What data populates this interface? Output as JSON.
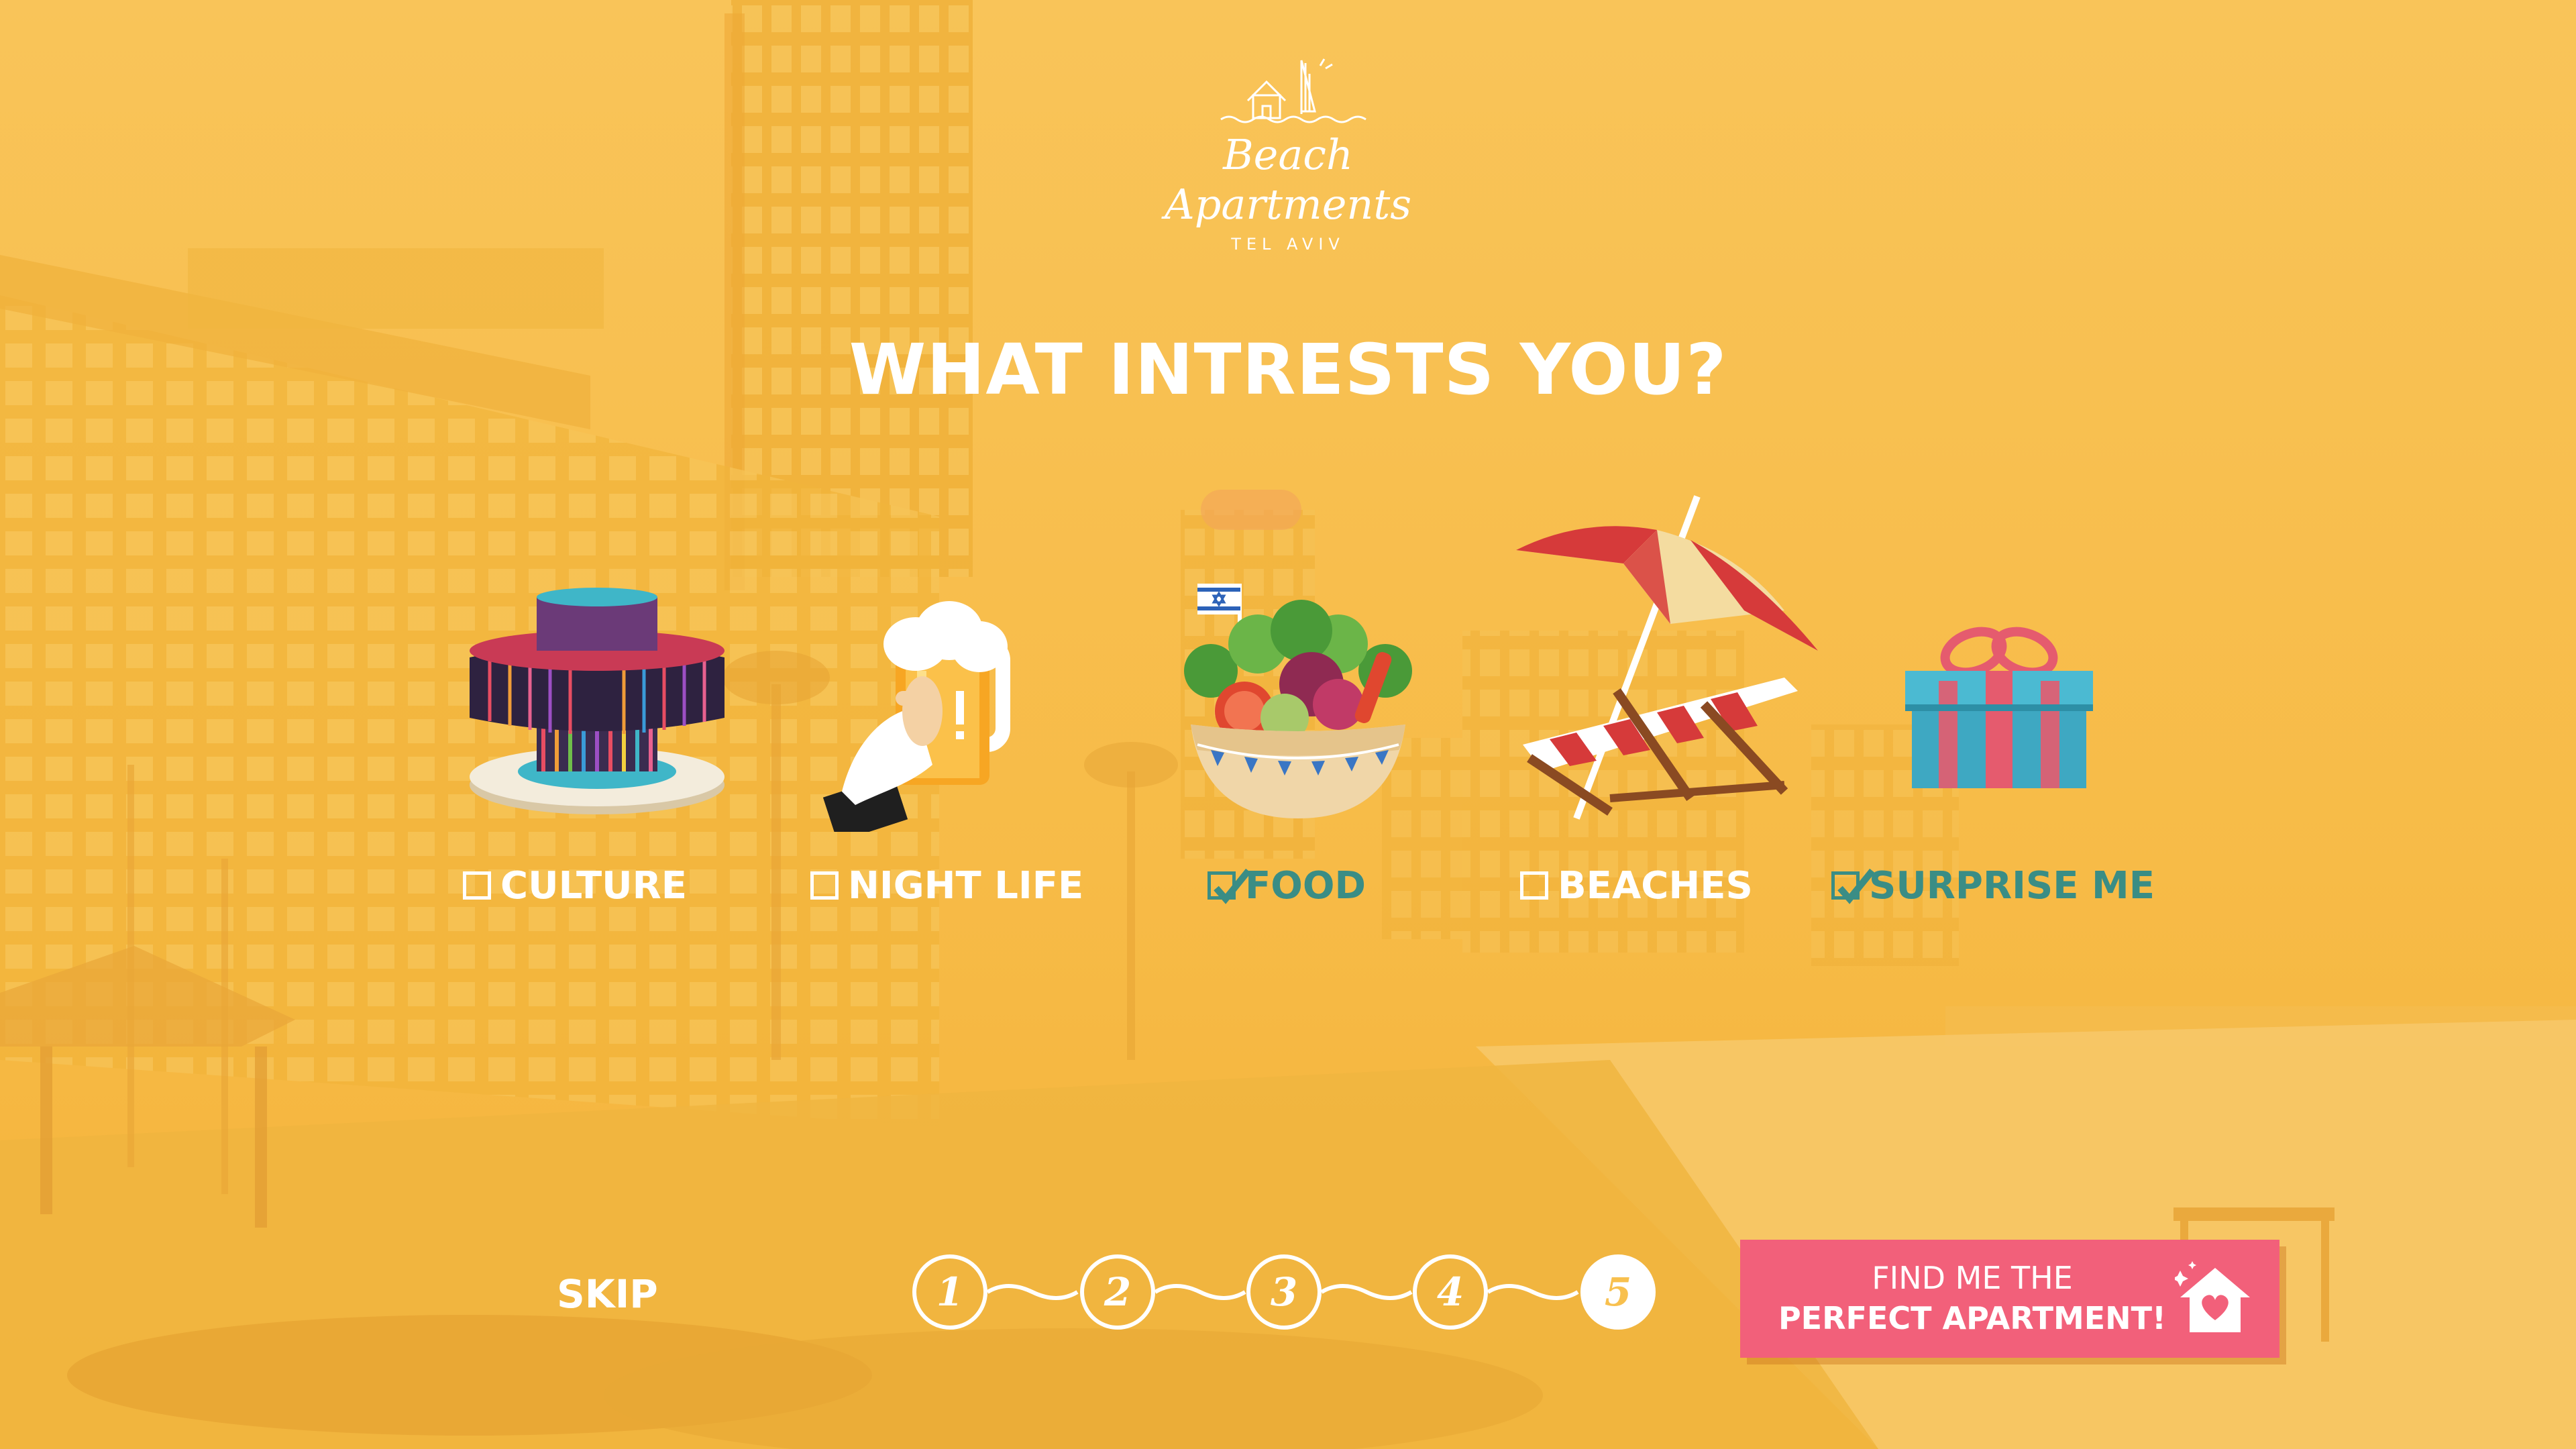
{
  "brand": {
    "line1": "Beach",
    "line2": "Apartments",
    "city": "TEL AVIV"
  },
  "headline": "WHAT INTRESTS YOU?",
  "options": [
    {
      "label": "CULTURE",
      "checked": false,
      "icon": "fountain-sculpture-icon"
    },
    {
      "label": "NIGHT LIFE",
      "checked": false,
      "icon": "beer-mug-icon"
    },
    {
      "label": "FOOD",
      "checked": true,
      "icon": "salad-bowl-icon"
    },
    {
      "label": "BEACHES",
      "checked": false,
      "icon": "beach-umbrella-chair-icon"
    },
    {
      "label": "SURPRISE ME",
      "checked": true,
      "icon": "gift-box-icon"
    }
  ],
  "skip": "SKIP",
  "steps": [
    "1",
    "2",
    "3",
    "4",
    "5"
  ],
  "active_step": 5,
  "cta": {
    "line1": "FIND ME THE",
    "line2": "PERFECT APARTMENT!",
    "icon": "heart-house-icon"
  },
  "colors": {
    "overlay": "#f8c04e",
    "accent": "#3a8d85",
    "cta": "#f2607a"
  }
}
